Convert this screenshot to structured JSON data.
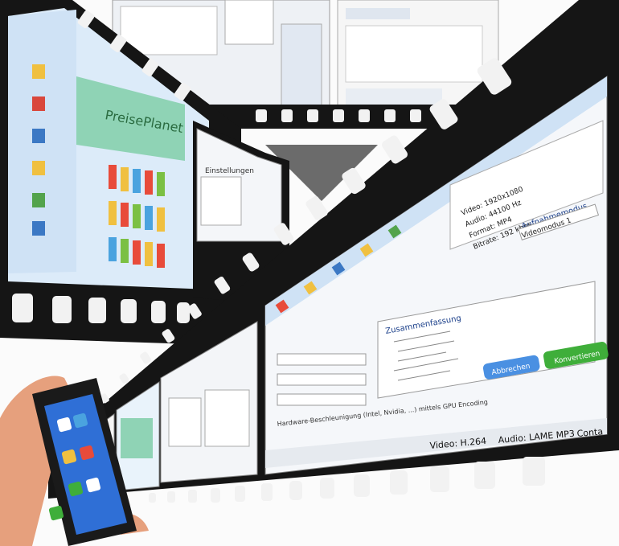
{
  "colors": {
    "film": "#151515",
    "film_hole": "#f2f2f2",
    "window_chrome": "#cfe2f5",
    "titlebar": "#3b78c4",
    "accent_green": "#3fae3a",
    "accent_blue": "#2f6fd6",
    "phone_body": "#1a1a1a",
    "hand": "#e6a07d",
    "bg": "#fbfbfb"
  },
  "icons": [
    "film-strip-icon",
    "film-sprocket-hole-icon",
    "phone-icon",
    "hand-icon",
    "folder-icon",
    "application-window-icon"
  ],
  "left_window": {
    "header_text": "PreisePlanet"
  },
  "main_window": {
    "status_bar": [
      "Video: H.264",
      "Audio: LAME MP3",
      "Conta"
    ],
    "primary_button": "Konvertieren",
    "secondary_button": "Abbrechen",
    "encoding_note": "Hardware-Beschleunigung (Intel, Nvidia, ...) mittels GPU Encoding",
    "tree_header": "Zusammenfassung",
    "settings_header": "Aufnahmemodus",
    "settings_value": "Videomodus 1",
    "right_panel_items": [
      "Video: 1920x1080",
      "Audio: 44100 Hz",
      "Format: MP4",
      "Bitrate: 192 kbps"
    ]
  },
  "side_window": {
    "label": "Einstellungen"
  }
}
